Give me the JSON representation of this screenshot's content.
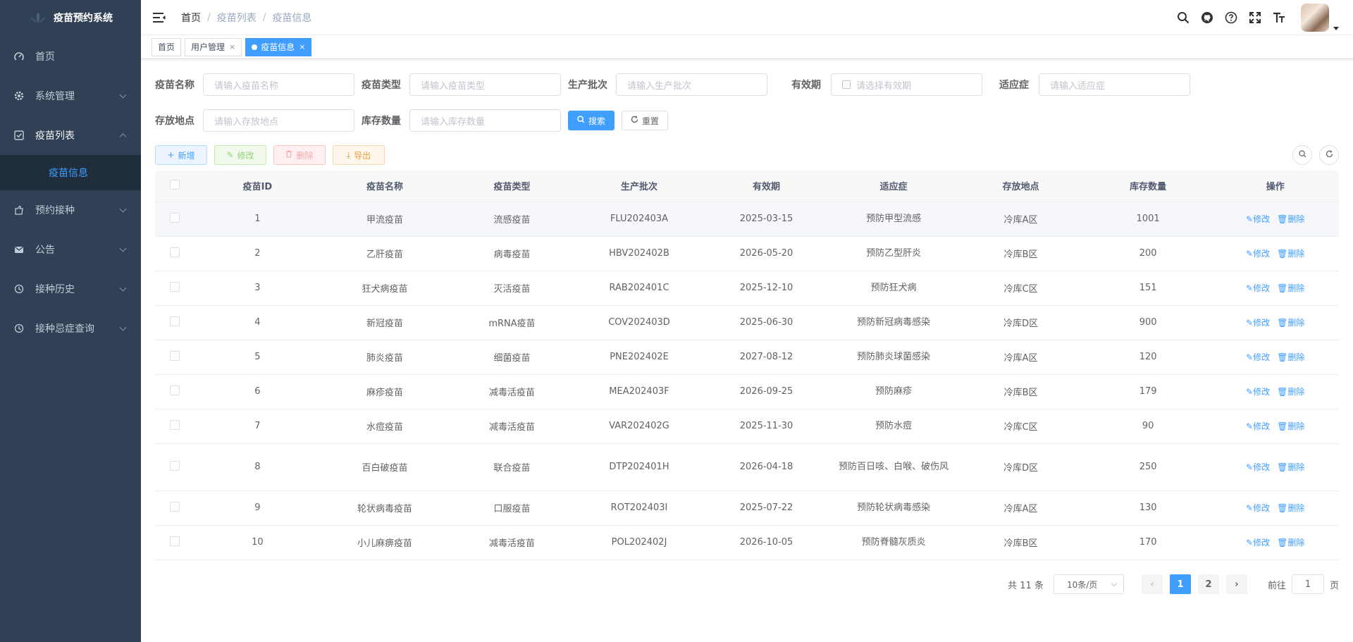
{
  "app": {
    "title": "疫苗预约系统"
  },
  "sidebar": {
    "items": [
      {
        "label": "首页",
        "icon": "dashboard-icon"
      },
      {
        "label": "系统管理",
        "icon": "gear-icon"
      },
      {
        "label": "疫苗列表",
        "icon": "checkbox-icon",
        "open": true
      },
      {
        "label": "预约接种",
        "icon": "hand-icon"
      },
      {
        "label": "公告",
        "icon": "mail-icon"
      },
      {
        "label": "接种历史",
        "icon": "history-icon"
      },
      {
        "label": "接种忌症查询",
        "icon": "query-icon"
      }
    ],
    "submenu": {
      "label": "疫苗信息"
    }
  },
  "breadcrumb": [
    "首页",
    "疫苗列表",
    "疫苗信息"
  ],
  "tags": [
    {
      "label": "首页"
    },
    {
      "label": "用户管理",
      "close": "×"
    },
    {
      "label": "疫苗信息",
      "close": "×"
    }
  ],
  "search": {
    "fields": [
      {
        "label": "疫苗名称",
        "placeholder": "请输入疫苗名称"
      },
      {
        "label": "疫苗类型",
        "placeholder": "请输入疫苗类型"
      },
      {
        "label": "生产批次",
        "placeholder": "请输入生产批次"
      },
      {
        "label": "有效期",
        "placeholder": "请选择有效期"
      },
      {
        "label": "适应症",
        "placeholder": "请输入适应症"
      },
      {
        "label": "存放地点",
        "placeholder": "请输入存放地点"
      },
      {
        "label": "库存数量",
        "placeholder": "请输入库存数量"
      }
    ],
    "search_label": "搜索",
    "reset_label": "重置"
  },
  "toolbar": {
    "add": "新增",
    "edit": "修改",
    "delete": "删除",
    "export": "导出"
  },
  "table": {
    "headers": [
      "疫苗ID",
      "疫苗名称",
      "疫苗类型",
      "生产批次",
      "有效期",
      "适应症",
      "存放地点",
      "库存数量",
      "操作"
    ],
    "op_edit": "修改",
    "op_delete": "删除",
    "rows": [
      [
        "1",
        "甲流疫苗",
        "流感疫苗",
        "FLU202403A",
        "2025-03-15",
        "预防甲型流感",
        "冷库A区",
        "1001"
      ],
      [
        "2",
        "乙肝疫苗",
        "病毒疫苗",
        "HBV202402B",
        "2026-05-20",
        "预防乙型肝炎",
        "冷库B区",
        "200"
      ],
      [
        "3",
        "狂犬病疫苗",
        "灭活疫苗",
        "RAB202401C",
        "2025-12-10",
        "预防狂犬病",
        "冷库C区",
        "151"
      ],
      [
        "4",
        "新冠疫苗",
        "mRNA疫苗",
        "COV202403D",
        "2025-06-30",
        "预防新冠病毒感染",
        "冷库D区",
        "900"
      ],
      [
        "5",
        "肺炎疫苗",
        "细菌疫苗",
        "PNE202402E",
        "2027-08-12",
        "预防肺炎球菌感染",
        "冷库A区",
        "120"
      ],
      [
        "6",
        "麻疹疫苗",
        "减毒活疫苗",
        "MEA202403F",
        "2026-09-25",
        "预防麻疹",
        "冷库B区",
        "179"
      ],
      [
        "7",
        "水痘疫苗",
        "减毒活疫苗",
        "VAR202402G",
        "2025-11-30",
        "预防水痘",
        "冷库C区",
        "90"
      ],
      [
        "8",
        "百白破疫苗",
        "联合疫苗",
        "DTP202401H",
        "2026-04-18",
        "预防百日咳、白喉、破伤风",
        "冷库D区",
        "250"
      ],
      [
        "9",
        "轮状病毒疫苗",
        "口服疫苗",
        "ROT202403I",
        "2025-07-22",
        "预防轮状病毒感染",
        "冷库A区",
        "130"
      ],
      [
        "10",
        "小儿麻痹疫苗",
        "减毒活疫苗",
        "POL202402J",
        "2026-10-05",
        "预防脊髓灰质炎",
        "冷库B区",
        "170"
      ]
    ]
  },
  "pagination": {
    "total": "共 11 条",
    "page_size": "10条/页",
    "pages": [
      "1",
      "2"
    ],
    "current": "1",
    "goto_prefix": "前往",
    "goto_value": "1",
    "goto_suffix": "页"
  },
  "colors": {
    "sidebar": "#304156",
    "primary": "#409eff"
  }
}
